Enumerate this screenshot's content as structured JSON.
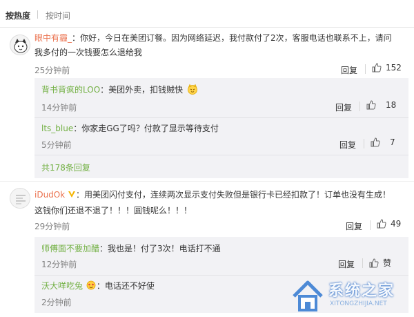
{
  "sort": {
    "hot": "按热度",
    "time": "按时间"
  },
  "comments": [
    {
      "user": "眼中有霾_",
      "text_line1": "：你好，今日在美团订餐。因为网络延迟，我付款付了2次，客服电话也联系不上，请问",
      "text_line2": "我多付的一次钱要怎么退给我",
      "time": "25分钟前",
      "reply_label": "回复",
      "likes": "152",
      "replies": [
        {
          "user": "背书背疯的LOO",
          "text": "：美团外卖，扣钱贼快",
          "time": "14分钟前",
          "reply_label": "回复",
          "likes": "18"
        },
        {
          "user": "lts_blue",
          "text": "：你家走GG了吗？付款了显示等待支付",
          "time": "5分钟前",
          "reply_label": "回复",
          "likes": "7"
        }
      ],
      "more": "共178条回复"
    },
    {
      "user": "iDudOk",
      "text_line1": "：用美团闪付支付，连续两次显示支付失败但是银行卡已经扣款了！订单也没有生成！",
      "text_line2": "这钱你们还退不退了！！！圆钱呢么！！！",
      "time": "29分钟前",
      "reply_label": "回复",
      "likes": "49",
      "replies": [
        {
          "user": "师傅面不要加醋",
          "text": "：我也是！付了3次！电话打不通",
          "time": "12分钟前",
          "reply_label": "回复",
          "likes": "赞"
        },
        {
          "user": "沃大咩吃兔",
          "text": "：电话还不好使",
          "time": "2分钟前",
          "reply_label": "回复",
          "likes": ""
        }
      ]
    }
  ],
  "watermark": {
    "text": "系统之家",
    "url": "XITONGZHIJIA.NET"
  }
}
